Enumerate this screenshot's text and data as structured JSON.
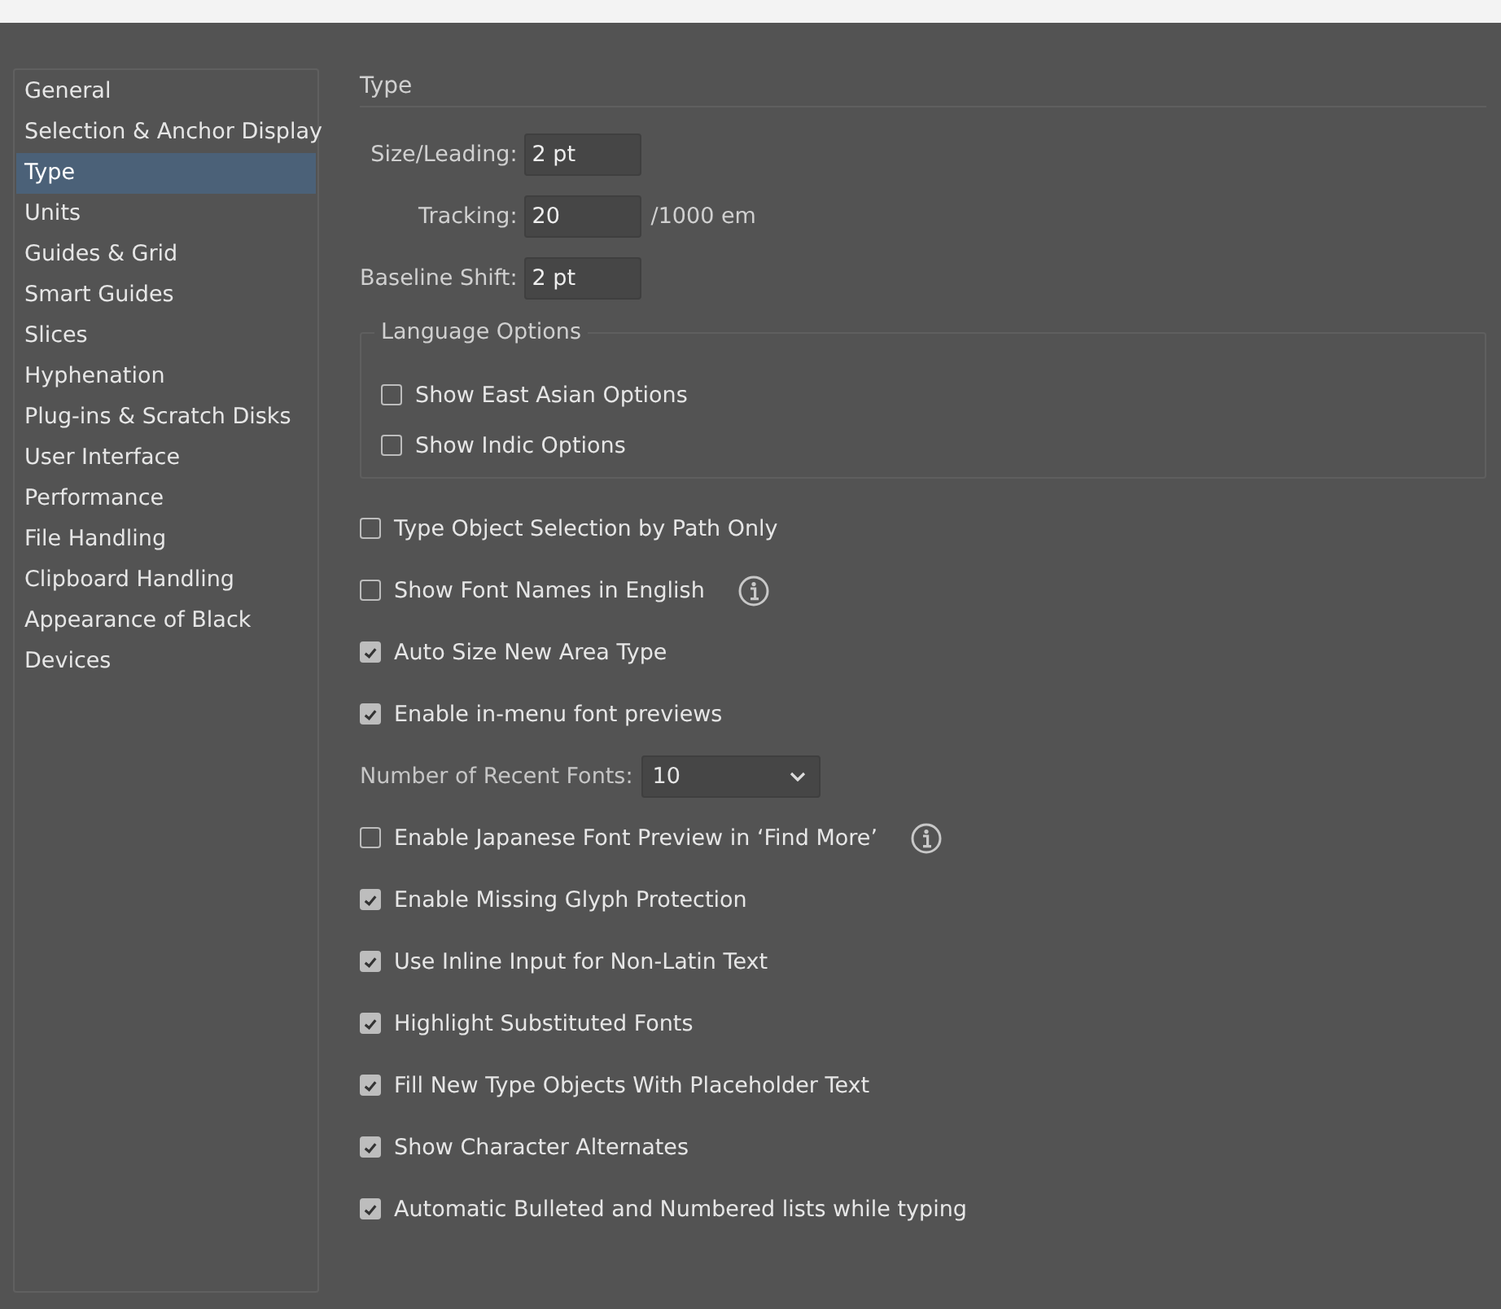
{
  "sidebar": {
    "items": [
      {
        "label": "General",
        "selected": false
      },
      {
        "label": "Selection & Anchor Display",
        "selected": false
      },
      {
        "label": "Type",
        "selected": true
      },
      {
        "label": "Units",
        "selected": false
      },
      {
        "label": "Guides & Grid",
        "selected": false
      },
      {
        "label": "Smart Guides",
        "selected": false
      },
      {
        "label": "Slices",
        "selected": false
      },
      {
        "label": "Hyphenation",
        "selected": false
      },
      {
        "label": "Plug-ins & Scratch Disks",
        "selected": false
      },
      {
        "label": "User Interface",
        "selected": false
      },
      {
        "label": "Performance",
        "selected": false
      },
      {
        "label": "File Handling",
        "selected": false
      },
      {
        "label": "Clipboard Handling",
        "selected": false
      },
      {
        "label": "Appearance of Black",
        "selected": false
      },
      {
        "label": "Devices",
        "selected": false
      }
    ]
  },
  "panel": {
    "title": "Type",
    "fields": [
      {
        "label": "Size/Leading:",
        "value": "2 pt"
      },
      {
        "label": "Tracking:",
        "value": "20",
        "unit": "/1000 em"
      },
      {
        "label": "Baseline Shift:",
        "value": "2 pt"
      }
    ],
    "language_options": {
      "title": "Language Options",
      "options": [
        {
          "label": "Show East Asian Options",
          "checked": false
        },
        {
          "label": "Show Indic Options",
          "checked": false
        }
      ]
    },
    "options": [
      {
        "kind": "checkbox",
        "label": "Type Object Selection by Path Only",
        "checked": false,
        "info": false
      },
      {
        "kind": "checkbox",
        "label": "Show Font Names in English",
        "checked": false,
        "info": true
      },
      {
        "kind": "checkbox",
        "label": "Auto Size New Area Type",
        "checked": true,
        "info": false
      },
      {
        "kind": "checkbox",
        "label": "Enable in-menu font previews",
        "checked": true,
        "info": false
      },
      {
        "kind": "dropdown",
        "label": "Number of Recent Fonts:",
        "value": "10"
      },
      {
        "kind": "checkbox",
        "label": "Enable Japanese Font Preview in ‘Find More’",
        "checked": false,
        "info": true
      },
      {
        "kind": "checkbox",
        "label": "Enable Missing Glyph Protection",
        "checked": true,
        "info": false
      },
      {
        "kind": "checkbox",
        "label": "Use Inline Input for Non-Latin Text",
        "checked": true,
        "info": false
      },
      {
        "kind": "checkbox",
        "label": "Highlight Substituted Fonts",
        "checked": true,
        "info": false
      },
      {
        "kind": "checkbox",
        "label": "Fill New Type Objects With Placeholder Text",
        "checked": true,
        "info": false
      },
      {
        "kind": "checkbox",
        "label": "Show Character Alternates",
        "checked": true,
        "info": false
      },
      {
        "kind": "checkbox",
        "label": "Automatic Bulleted and Numbered lists while typing",
        "checked": true,
        "info": false
      }
    ]
  }
}
